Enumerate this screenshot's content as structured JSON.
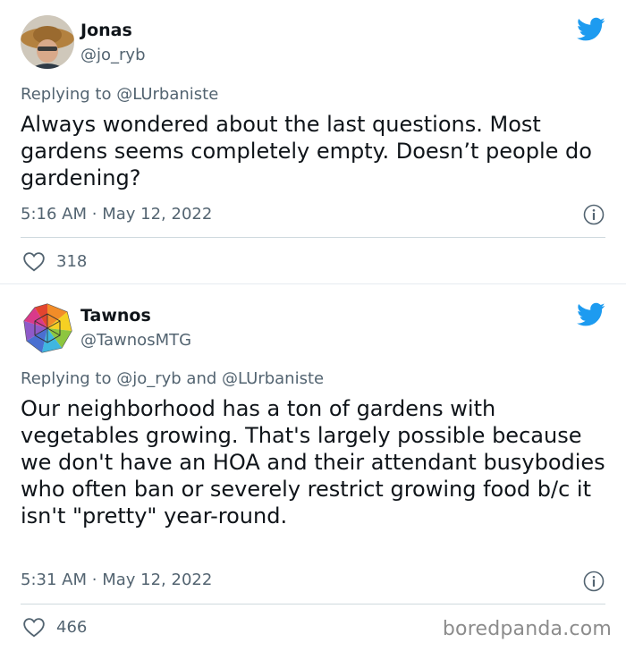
{
  "tweets": [
    {
      "name": "Jonas",
      "handle": "@jo_ryb",
      "replying_prefix": "Replying to",
      "mentions": "@LUrbaniste",
      "text": "Always wondered about the last questions. Most gardens seems completely empty. Doesn’t people do gardening?",
      "time": "5:16 AM",
      "dot": "·",
      "date": "May 12, 2022",
      "likes": "318"
    },
    {
      "name": "Tawnos",
      "handle": "@TawnosMTG",
      "replying_prefix": "Replying to",
      "mentions": "@jo_ryb and @LUrbaniste",
      "text": "Our neighborhood has a ton of gardens with vegetables growing. That's largely possible because we don't have an HOA and their attendant busybodies who often ban or severely restrict growing food b/c it isn't \"pretty\" year-round.",
      "time": "5:31 AM",
      "dot": "·",
      "date": "May 12, 2022",
      "likes": "466"
    }
  ],
  "icons": {
    "brand": "twitter-bird-icon",
    "info": "info-icon",
    "like": "heart-icon"
  },
  "colors": {
    "twitter_blue": "#1d9bf0",
    "secondary_text": "#536471",
    "primary_text": "#0f1419"
  },
  "watermark": "boredpanda.com"
}
